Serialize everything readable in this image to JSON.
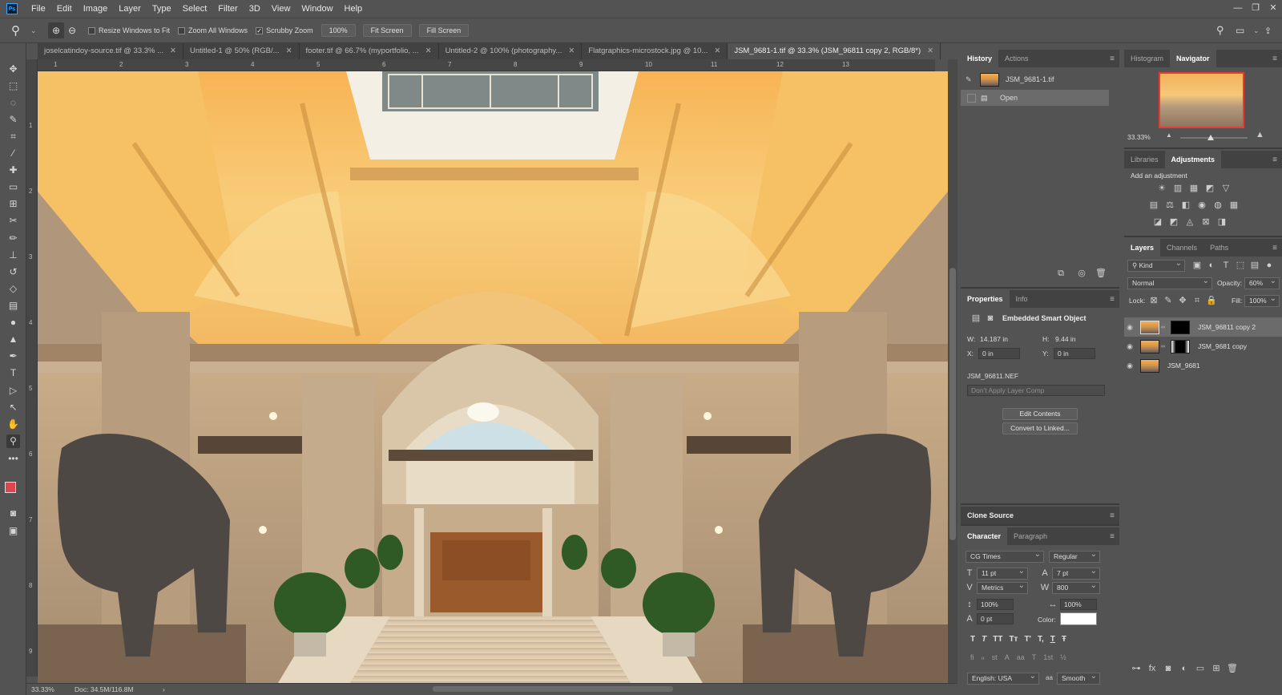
{
  "menu": {
    "logo": "Ps",
    "items": [
      "File",
      "Edit",
      "Image",
      "Layer",
      "Type",
      "Select",
      "Filter",
      "3D",
      "View",
      "Window",
      "Help"
    ]
  },
  "window_controls": {
    "min": "—",
    "restore": "❐",
    "close": "✕"
  },
  "options": {
    "resize_windows": "Resize Windows to Fit",
    "zoom_all": "Zoom All Windows",
    "scrubby": "Scrubby Zoom",
    "zoom_value": "100%",
    "fit_screen": "Fit Screen",
    "fill_screen": "Fill Screen",
    "check": "✓"
  },
  "tabs": [
    {
      "label": "joselcatindoy-source.tif @ 33.3% ...",
      "close": "✕"
    },
    {
      "label": "Untitled-1 @ 50% (RGB/...",
      "close": "✕"
    },
    {
      "label": "footer.tif @ 66.7% (myportfolio, ...",
      "close": "✕"
    },
    {
      "label": "Untitled-2 @ 100% (photography...",
      "close": "✕"
    },
    {
      "label": "Flatgraphics-microstock.jpg @ 10...",
      "close": "✕"
    },
    {
      "label": "JSM_9681-1.tif @ 33.3% (JSM_96811 copy 2, RGB/8*)",
      "close": "✕"
    }
  ],
  "ruler": {
    "top": [
      "1",
      "2",
      "3",
      "4",
      "5",
      "6",
      "7",
      "8",
      "9",
      "10",
      "11",
      "12",
      "13"
    ],
    "left": [
      "1",
      "2",
      "3",
      "4",
      "5",
      "6",
      "7",
      "8",
      "9"
    ]
  },
  "status": {
    "zoom": "33.33%",
    "doc": "Doc: 34.5M/116.8M",
    "arrow": "›"
  },
  "history": {
    "tabs": [
      "History",
      "Actions"
    ],
    "snapshot": "JSM_9681-1.tif",
    "step": "Open"
  },
  "navigator": {
    "tabs": [
      "Histogram",
      "Navigator"
    ],
    "zoom": "33.33%"
  },
  "adjustments": {
    "tabs": [
      "Libraries",
      "Adjustments"
    ],
    "heading": "Add an adjustment",
    "icons": [
      "☀",
      "▥",
      "▦",
      "◩",
      "▽",
      "▤",
      "⚖",
      "◧",
      "◉",
      "◍",
      "▦",
      "◪",
      "◩",
      "◬",
      "⊠",
      "◨"
    ]
  },
  "layers": {
    "tabs": [
      "Layers",
      "Channels",
      "Paths"
    ],
    "kind": "Kind",
    "blend": "Normal",
    "opacity_label": "Opacity:",
    "opacity": "60%",
    "lock_label": "Lock:",
    "fill_label": "Fill:",
    "fill": "100%",
    "items": [
      {
        "name": "JSM_96811 copy 2",
        "mask": true,
        "selected": true
      },
      {
        "name": "JSM_9681 copy",
        "mask": true,
        "selected": false
      },
      {
        "name": "JSM_9681",
        "mask": false,
        "selected": false
      }
    ]
  },
  "properties": {
    "tabs": [
      "Properties",
      "Info"
    ],
    "title": "Embedded Smart Object",
    "w_label": "W:",
    "w": "14.187 in",
    "h_label": "H:",
    "h": "9.44 in",
    "x_label": "X:",
    "x": "0 in",
    "y_label": "Y:",
    "y": "0 in",
    "file": "JSM_96811.NEF",
    "comp": "Don't Apply Layer Comp",
    "edit": "Edit Contents",
    "convert": "Convert to Linked..."
  },
  "clone": {
    "title": "Clone Source"
  },
  "character": {
    "tabs": [
      "Character",
      "Paragraph"
    ],
    "font": "CG Times",
    "style": "Regular",
    "size": "11 pt",
    "leading": "7 pt",
    "kerning": "Metrics",
    "tracking": "800",
    "vscale": "100%",
    "hscale": "100%",
    "baseline": "0 pt",
    "color_label": "Color:",
    "color": "#ffffff",
    "typebuttons": [
      "T",
      "T",
      "TT",
      "Tт",
      "T'",
      "T,",
      "T",
      "Ŧ"
    ],
    "otbuttons": [
      "ﬁ",
      "ℴ",
      "st",
      "A",
      "aa",
      "T",
      "1st",
      "½"
    ],
    "language": "English: USA",
    "aa": "Smooth"
  },
  "colors": {
    "foreground": "#e0454f",
    "background": "#c8c8c8"
  }
}
